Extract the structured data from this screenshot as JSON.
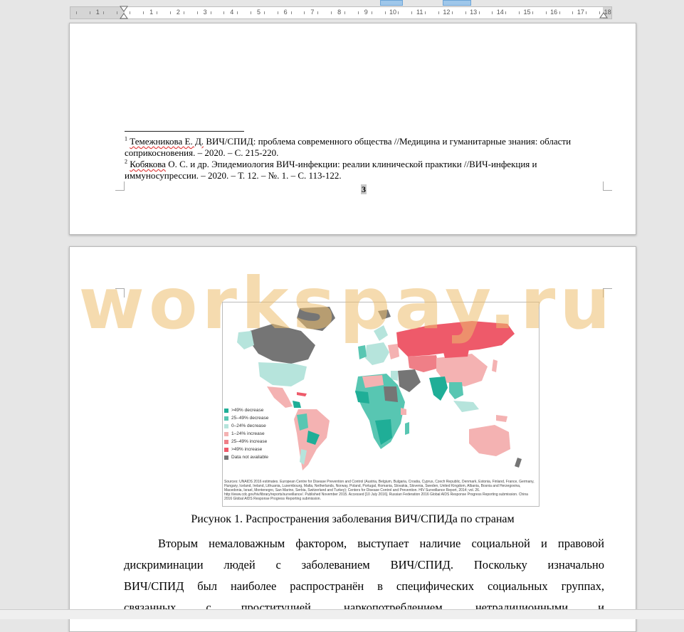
{
  "ruler": {
    "numbers": [
      "1",
      "1",
      "2",
      "3",
      "4",
      "5",
      "6",
      "7",
      "8",
      "9",
      "10",
      "11",
      "12",
      "13",
      "14",
      "15",
      "16",
      "17",
      "18"
    ]
  },
  "page1": {
    "footnotes": [
      {
        "sup": "1",
        "author": "Темежникова Е. Д.",
        "text": " ВИЧ/СПИД: проблема современного общества //Медицина и гуманитарные знания: области соприкосновения. – 2020. – С. 215-220."
      },
      {
        "sup": "2",
        "author": "Кобякова",
        "text": " О. С. и др. Эпидемиология ВИЧ-инфекции: реалии клинической практики //ВИЧ-инфекция и иммуносупрессии. – 2020. – Т. 12. – №. 1. – С. 113-122."
      }
    ],
    "page_number": "3"
  },
  "page2": {
    "map": {
      "legend": [
        {
          "label": ">49% decrease",
          "color": "#1fae97"
        },
        {
          "label": "25–49% decrease",
          "color": "#58c6b2"
        },
        {
          "label": "0–24% decrease",
          "color": "#b6e4dc"
        },
        {
          "label": "1–24% increase",
          "color": "#f4b2b2"
        },
        {
          "label": "25–49% increase",
          "color": "#ef7f87"
        },
        {
          "label": ">49% increase",
          "color": "#ee5a6a"
        },
        {
          "label": "Data not available",
          "color": "#757575"
        }
      ],
      "sources": "Sources: UNAIDS 2016 estimates. European Centre for Disease Prevention and Control (Austria, Belgium, Bulgaria, Croatia, Cyprus, Czech Republic, Denmark, Estonia, Finland, France, Germany, Hungary, Iceland, Ireland, Lithuania, Luxembourg, Malta, Netherlands, Norway, Poland, Portugal, Romania, Slovakia, Slovenia, Sweden, United Kingdom, Albania, Bosnia and Herzegovina, Macedonia, Israel, Montenegro, San Marino, Serbia, Switzerland and Turkey); Centers for Disease Control and Prevention. HIV Surveillance Report, 2014; vol. 26. http://www.cdc.gov/hiv/library/reports/surveillance/. Published November 2015. Accessed [10 July 2016]. Russian Federation 2016 Global AIDS Response Progress Reporting submission. China 2016 Global AIDS Response Progress Reporting submission."
    },
    "caption": "Рисунок 1. Распространения заболевания ВИЧ/СПИДа по странам",
    "paragraph_lines": [
      "Вторым немаловажным фактором, выступает наличие социальной и правовой",
      "дискриминации людей с заболеванием ВИЧ/СПИД. Поскольку изначально",
      "ВИЧ/СПИД был наиболее распространён в специфических социальных группах,",
      "связанных с проституцией, наркопотреблением, нетрадиционными и"
    ]
  },
  "watermark": "workspay.ru"
}
